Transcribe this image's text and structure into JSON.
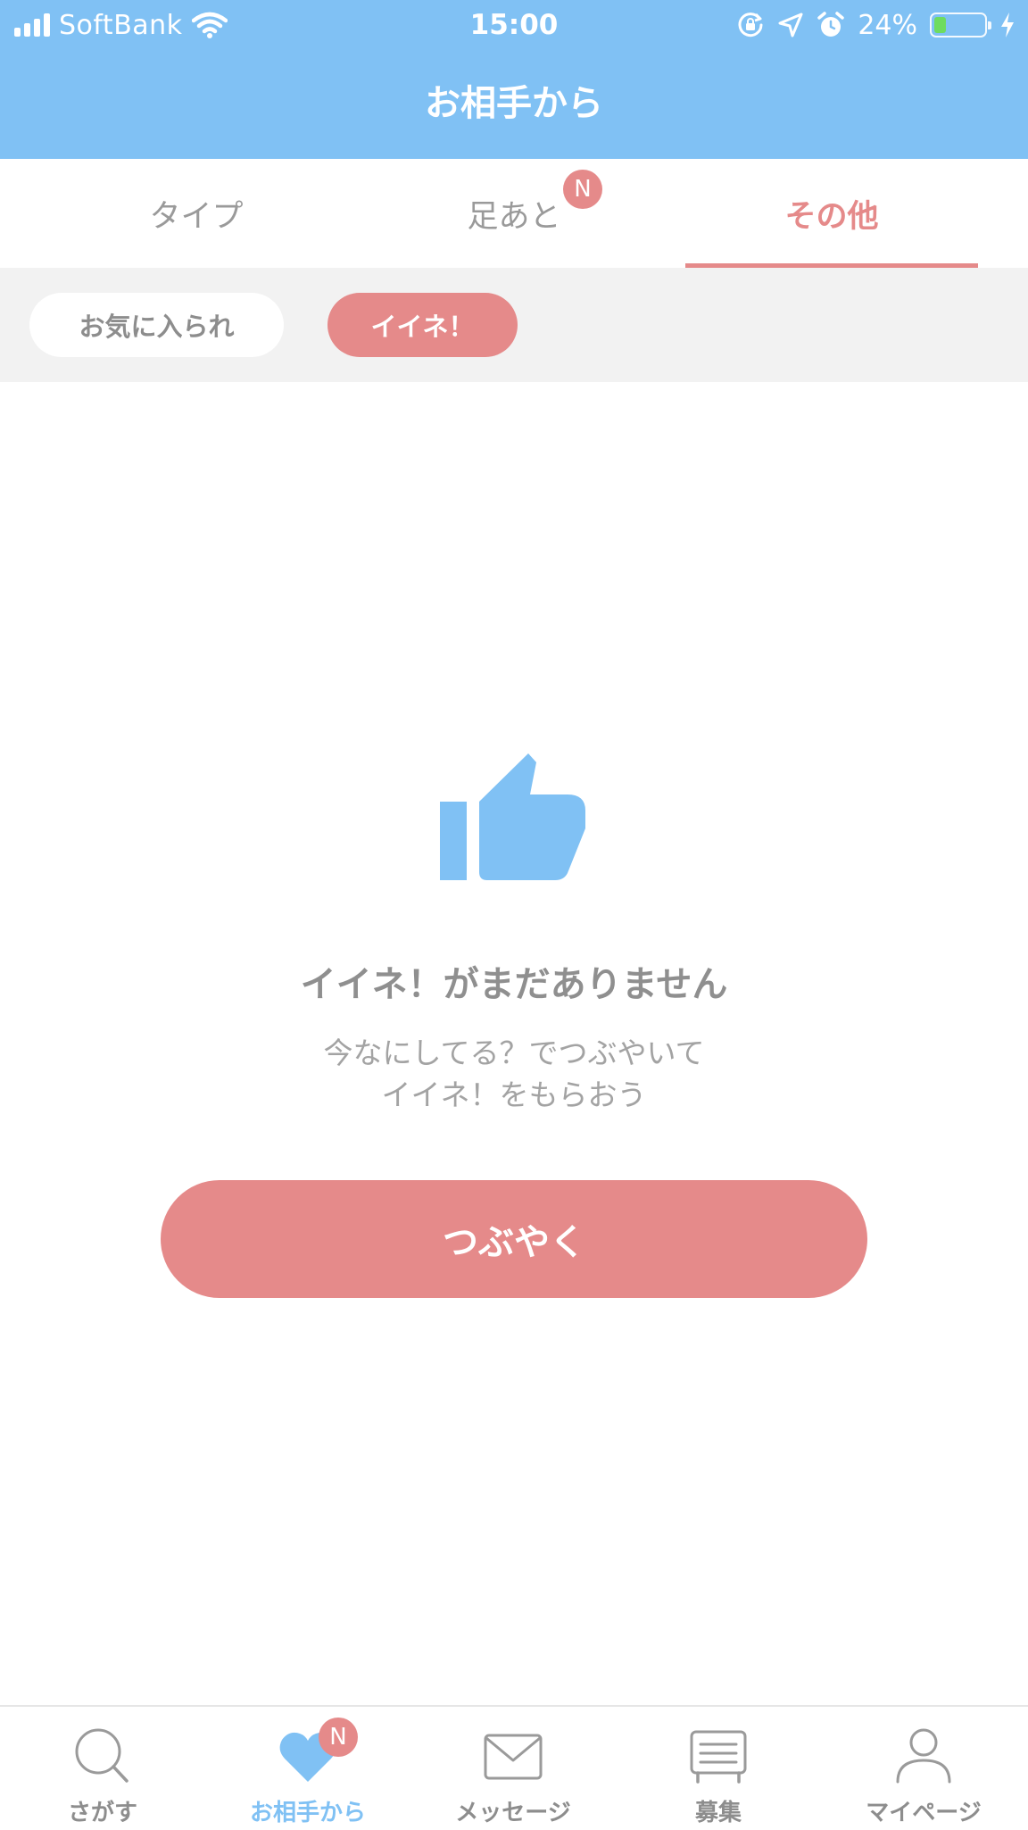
{
  "status_bar": {
    "carrier": "SoftBank",
    "time": "15:00",
    "battery_percent_text": "24%",
    "battery_level": 0.24
  },
  "header": {
    "title": "お相手から"
  },
  "tabs": [
    {
      "label": "タイプ",
      "active": false
    },
    {
      "label": "足あと",
      "active": false,
      "badge": "N"
    },
    {
      "label": "その他",
      "active": true
    }
  ],
  "filters": [
    {
      "label": "お気に入られ",
      "active": false
    },
    {
      "label": "イイネ！",
      "active": true
    }
  ],
  "empty_state": {
    "icon": "thumbs-up-icon",
    "title": "イイネ！がまだありません",
    "description_line1": "今なにしてる？でつぶやいて",
    "description_line2": "イイネ！をもらおう",
    "button_label": "つぶやく"
  },
  "bottom_nav": [
    {
      "label": "さがす",
      "icon": "search-icon",
      "active": false
    },
    {
      "label": "お相手から",
      "icon": "heart-icon",
      "active": true,
      "badge": "N"
    },
    {
      "label": "メッセージ",
      "icon": "envelope-icon",
      "active": false
    },
    {
      "label": "募集",
      "icon": "board-icon",
      "active": false
    },
    {
      "label": "マイページ",
      "icon": "person-icon",
      "active": false
    }
  ],
  "colors": {
    "header_blue": "#80c1f4",
    "accent_pink": "#e58a8a",
    "text_gray": "#8f8f8f",
    "filter_bg": "#f2f2f2"
  }
}
